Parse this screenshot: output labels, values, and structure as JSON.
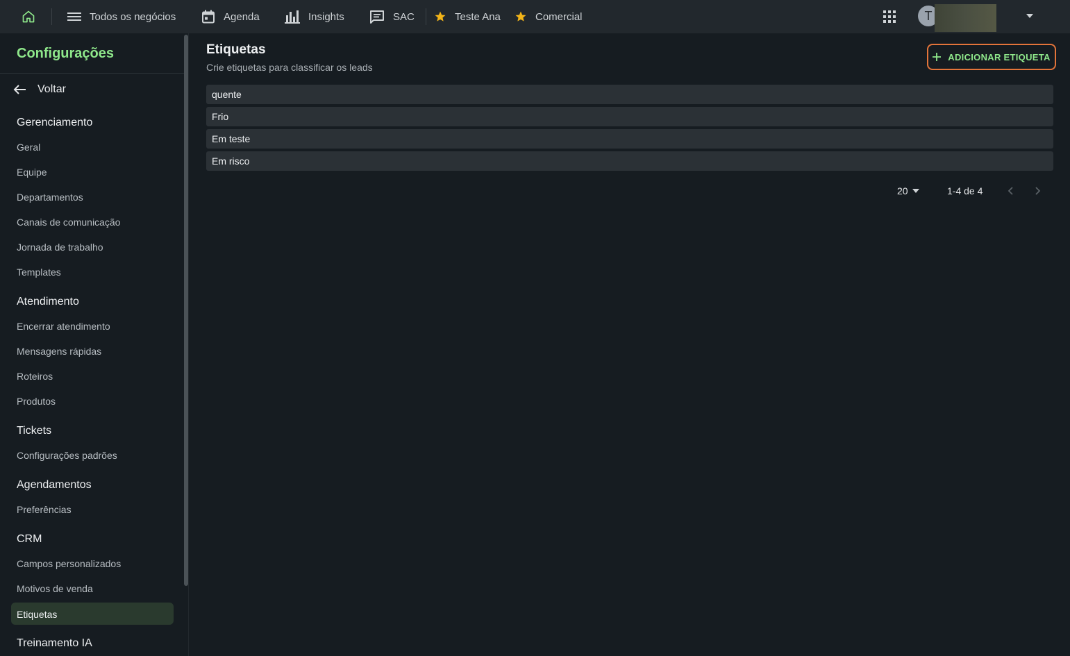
{
  "topbar": {
    "nav": [
      {
        "label": "Todos os negócios",
        "icon": "menu-icon"
      },
      {
        "label": "Agenda",
        "icon": "calendar-icon"
      },
      {
        "label": "Insights",
        "icon": "bar-chart-icon"
      },
      {
        "label": "SAC",
        "icon": "chat-icon"
      },
      {
        "label": "Teste Ana",
        "icon": "star-icon"
      },
      {
        "label": "Comercial",
        "icon": "star-icon"
      }
    ],
    "avatar_initial": "T"
  },
  "sidebar": {
    "title": "Configurações",
    "back_label": "Voltar",
    "sections": [
      {
        "title": "Gerenciamento",
        "items": [
          "Geral",
          "Equipe",
          "Departamentos",
          "Canais de comunicação",
          "Jornada de trabalho",
          "Templates"
        ]
      },
      {
        "title": "Atendimento",
        "items": [
          "Encerrar atendimento",
          "Mensagens rápidas",
          "Roteiros",
          "Produtos"
        ]
      },
      {
        "title": "Tickets",
        "items": [
          "Configurações padrões"
        ]
      },
      {
        "title": "Agendamentos",
        "items": [
          "Preferências"
        ]
      },
      {
        "title": "CRM",
        "items": [
          "Campos personalizados",
          "Motivos de venda",
          "Etiquetas"
        ]
      },
      {
        "title": "Treinamento IA",
        "items": []
      }
    ],
    "active_item": "Etiquetas"
  },
  "main": {
    "title": "Etiquetas",
    "subtitle": "Crie etiquetas para classificar os leads",
    "add_button_label": "ADICIONAR ETIQUETA",
    "tags": [
      "quente",
      "Frio",
      "Em teste",
      "Em risco"
    ],
    "pagination": {
      "page_size": "20",
      "range": "1-4 de 4"
    }
  },
  "colors": {
    "accent_green": "#8fe88b",
    "button_border": "#e3743a",
    "star": "#f2b418"
  }
}
